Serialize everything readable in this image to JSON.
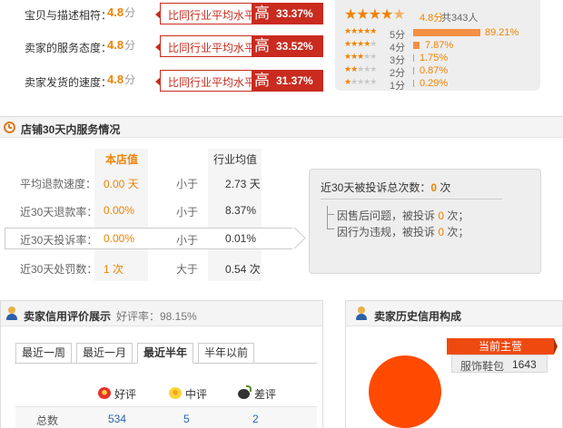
{
  "dsr": {
    "rows": [
      {
        "label": "宝贝与描述相符：",
        "score": "4.8",
        "unit": "分",
        "compare_text": "比同行业平均水平",
        "compare_word": "高",
        "compare_pct": "33.37%"
      },
      {
        "label": "卖家的服务态度：",
        "score": "4.8",
        "unit": "分",
        "compare_text": "比同行业平均水平",
        "compare_word": "高",
        "compare_pct": "33.52%"
      },
      {
        "label": "卖家发货的速度：",
        "score": "4.8",
        "unit": "分",
        "compare_text": "比同行业平均水平",
        "compare_word": "高",
        "compare_pct": "31.37%"
      }
    ],
    "distribution": {
      "score": "4.8分",
      "total": "共343人",
      "rows": [
        {
          "label": "5分",
          "percent": "89.21%",
          "value": 89.21
        },
        {
          "label": "4分",
          "percent": "7.87%",
          "value": 7.87
        },
        {
          "label": "3分",
          "percent": "1.75%",
          "value": 1.75
        },
        {
          "label": "2分",
          "percent": "0.87%",
          "value": 0.87
        },
        {
          "label": "1分",
          "percent": "0.29%",
          "value": 0.29
        }
      ]
    }
  },
  "service": {
    "title": "店铺30天内服务情况",
    "col_shop": "本店值",
    "col_industry": "行业均值",
    "rows": [
      {
        "label": "平均退款速度：",
        "shop": "0.00 天",
        "cmp": "小于",
        "industry": "2.73 天"
      },
      {
        "label": "近30天退款率：",
        "shop": "0.00%",
        "cmp": "小于",
        "industry": "8.37%"
      },
      {
        "label": "近30天投诉率：",
        "shop": "0.00%",
        "cmp": "小于",
        "industry": "0.01%"
      },
      {
        "label": "近30天处罚数：",
        "shop": "1 次",
        "cmp": "大于",
        "industry": "0.54 次"
      }
    ],
    "complaints": {
      "title_prefix": "近30天被投诉总次数：",
      "total": "0",
      "title_suffix": " 次",
      "items": [
        {
          "prefix": "因售后问题，被投诉 ",
          "count": "0",
          "suffix": " 次；"
        },
        {
          "prefix": "因行为违规，被投诉 ",
          "count": "0",
          "suffix": " 次；"
        }
      ]
    }
  },
  "credit": {
    "title": "卖家信用评价展示",
    "rate_label": "好评率：98.15%",
    "tabs": [
      "最近一周",
      "最近一月",
      "最近半年",
      "半年以前"
    ],
    "active_tab": 2,
    "headers": {
      "good": "好评",
      "neutral": "中评",
      "bad": "差评"
    },
    "total_row": {
      "label": "总数",
      "good": "534",
      "neutral": "5",
      "bad": "2"
    }
  },
  "history": {
    "title": "卖家历史信用构成",
    "main_label": "当前主营",
    "category": "服饰鞋包",
    "count": "1643"
  },
  "colors": {
    "accent_orange": "#f08300",
    "compare_red": "#c92b1f",
    "pie_orange": "#ff4a00",
    "link_blue": "#2464b0"
  }
}
